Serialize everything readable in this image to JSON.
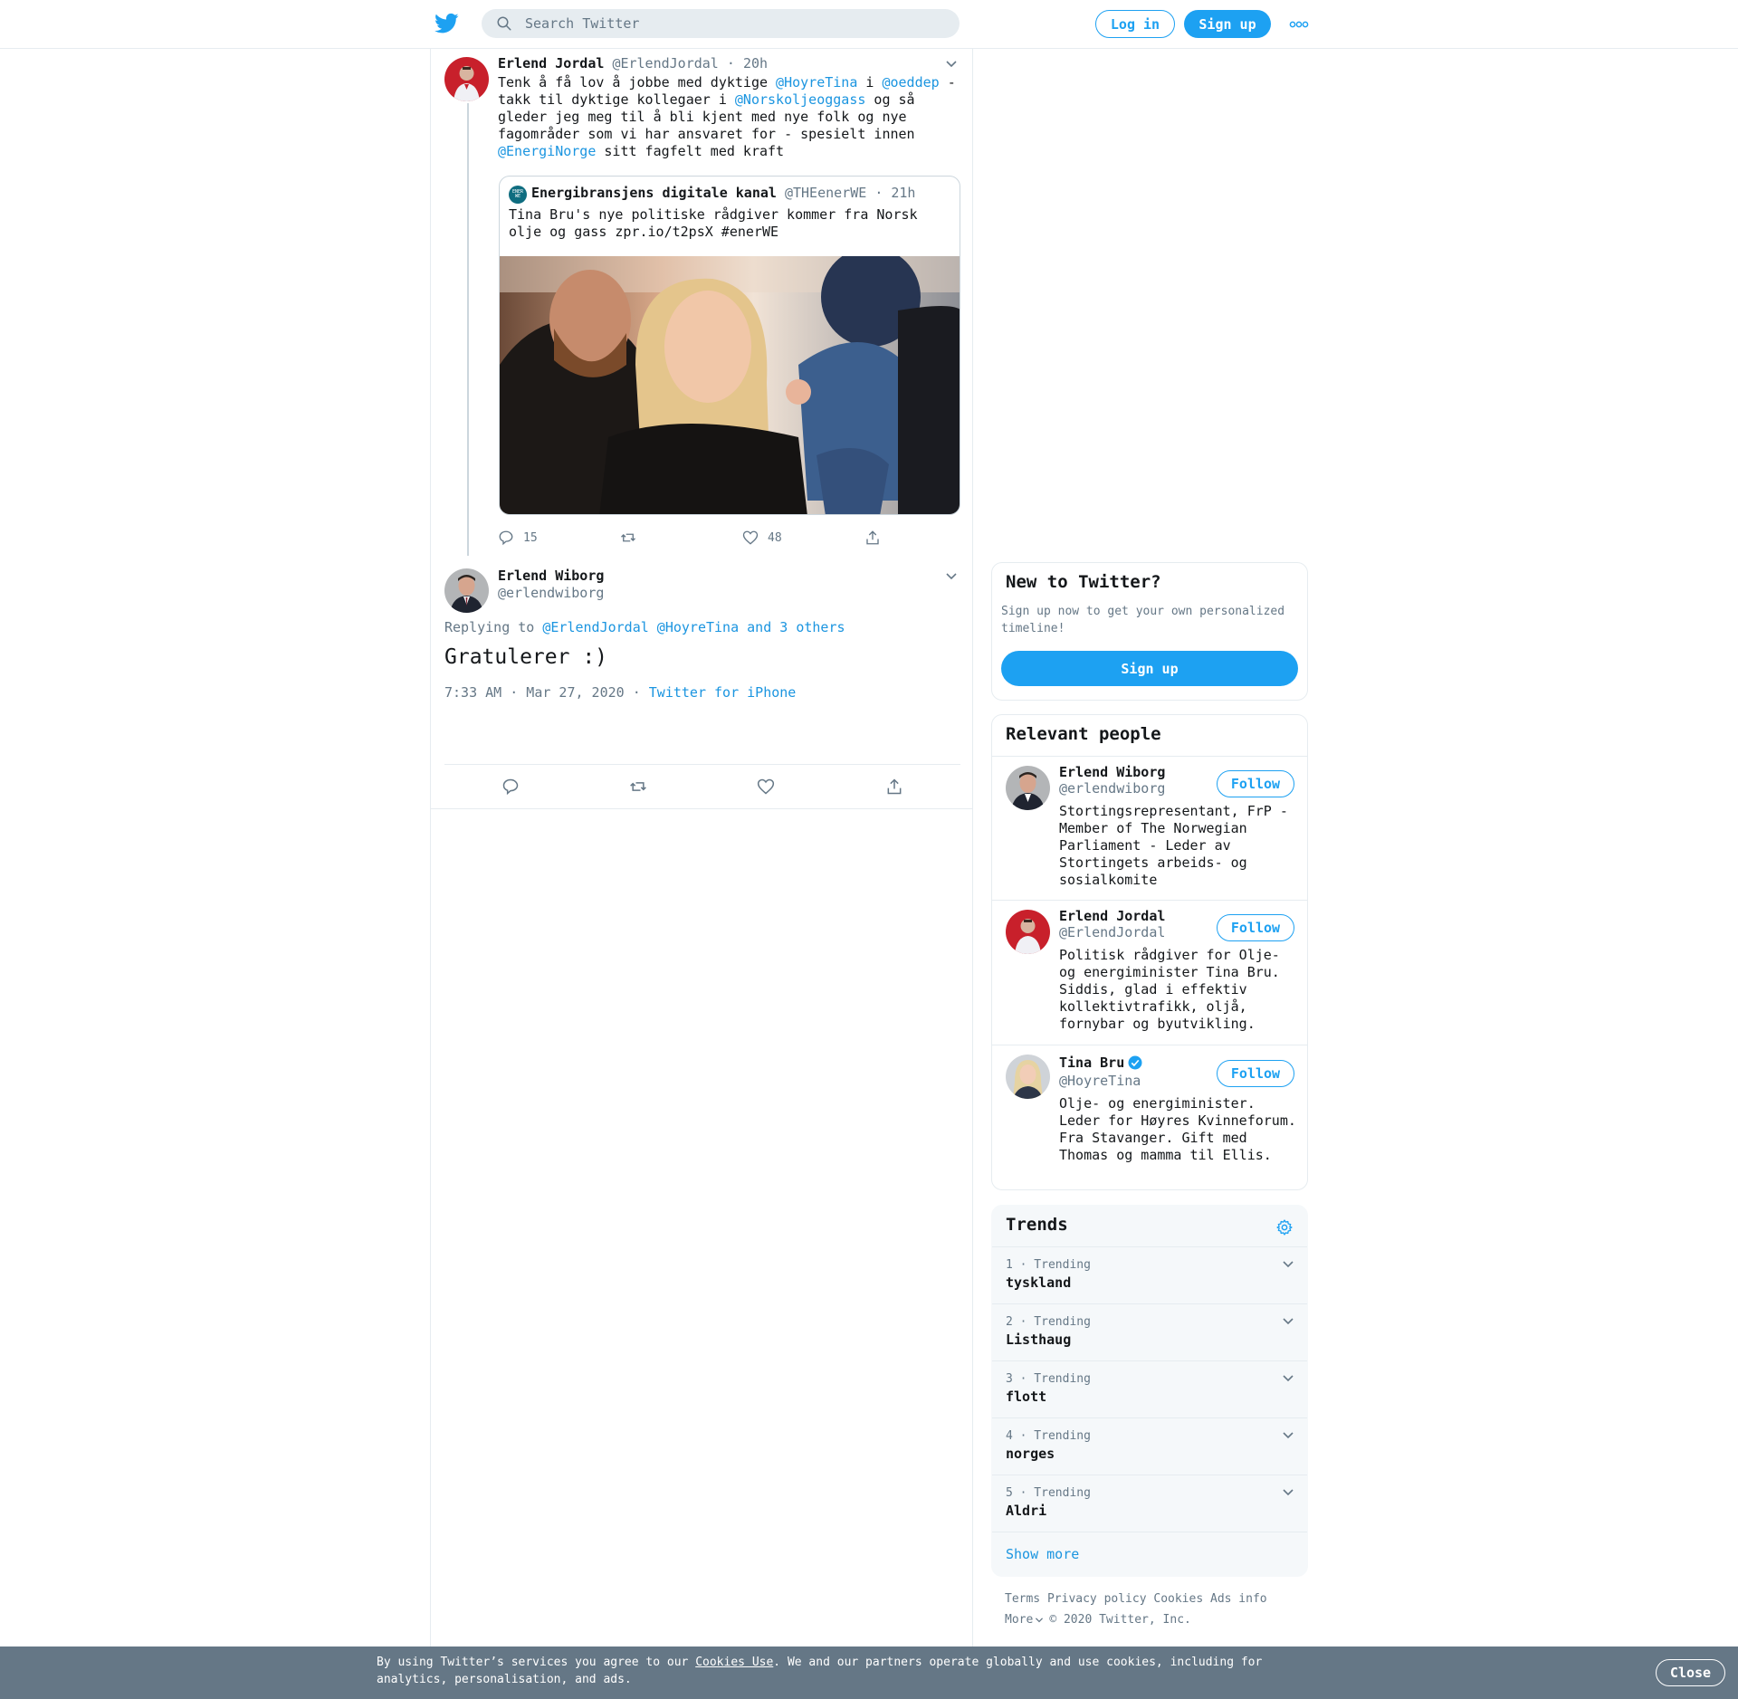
{
  "header": {
    "search_placeholder": "Search Twitter",
    "login_label": "Log in",
    "signup_label": "Sign up"
  },
  "thread": {
    "parent": {
      "name": "Erlend Jordal",
      "handle": "@ErlendJordal",
      "time": "20h",
      "text_parts": {
        "t1": "Tenk å få lov å jobbe med dyktige ",
        "m1": "@HoyreTina",
        "t2": " i ",
        "m2": "@oeddep",
        "t3": " - takk til dyktige kollegaer i ",
        "m3": "@Norskoljeoggass",
        "t4": " og så gleder jeg meg til å bli kjent med nye folk og nye fagområder som vi har ansvaret for - spesielt innen ",
        "m4": "@EnergiNorge",
        "t5": " sitt fagfelt med kraft"
      },
      "quote": {
        "name": "Energibransjens digitale kanal",
        "handle": "@THEenerWE",
        "time": "21h",
        "text": "Tina Bru's nye politiske rådgiver kommer fra Norsk olje og gass zpr.io/t2psX #enerWE",
        "logo_text": "ENER WE"
      },
      "reply_count": "15",
      "like_count": "48"
    },
    "main": {
      "name": "Erlend Wiborg",
      "handle": "@erlendwiborg",
      "replying_label": "Replying to",
      "reply_mentions": "@ErlendJordal @HoyreTina and 3 others",
      "text": "Gratulerer :)",
      "timestamp": "7:33 AM · Mar 27, 2020",
      "source": "Twitter for iPhone"
    }
  },
  "sidebar": {
    "new_to_twitter": {
      "title": "New to Twitter?",
      "subtitle": "Sign up now to get your own personalized timeline!",
      "button": "Sign up"
    },
    "relevant_people": {
      "title": "Relevant people",
      "follow_label": "Follow",
      "people": [
        {
          "name": "Erlend Wiborg",
          "handle": "@erlendwiborg",
          "bio": "Stortingsrepresentant, FrP - Member of The Norwegian Parliament - Leder av Stortingets arbeids- og sosialkomite"
        },
        {
          "name": "Erlend Jordal",
          "handle": "@ErlendJordal",
          "bio": "Politisk rådgiver for Olje- og energiminister Tina Bru. Siddis, glad i effektiv kollektivtrafikk, oljå, fornybar og byutvikling."
        },
        {
          "name": "Tina Bru",
          "handle": "@HoyreTina",
          "bio": "Olje- og energiminister. Leder for Høyres Kvinneforum. Fra Stavanger. Gift med Thomas og mamma til Ellis.",
          "verified": true
        }
      ]
    },
    "trends": {
      "title": "Trends",
      "items": [
        {
          "meta": "1 · Trending",
          "name": "tyskland"
        },
        {
          "meta": "2 · Trending",
          "name": "Listhaug"
        },
        {
          "meta": "3 · Trending",
          "name": "flott"
        },
        {
          "meta": "4 · Trending",
          "name": "norges"
        },
        {
          "meta": "5 · Trending",
          "name": "Aldri"
        }
      ],
      "show_more": "Show more"
    },
    "footer": {
      "terms": "Terms",
      "privacy": "Privacy policy",
      "cookies": "Cookies",
      "ads": "Ads info",
      "more": "More",
      "copyright": "© 2020 Twitter, Inc."
    }
  },
  "cookie_bar": {
    "text_before": "By using Twitter’s services you agree to our ",
    "link": "Cookies Use",
    "text_after": ". We and our partners operate globally and use cookies, including for analytics, personalisation, and ads.",
    "close": "Close"
  },
  "colors": {
    "brand": "#1da1f2",
    "link": "#1b95e0",
    "muted": "#657786",
    "border": "#e6ecf0",
    "cookie_bg": "#657786"
  }
}
